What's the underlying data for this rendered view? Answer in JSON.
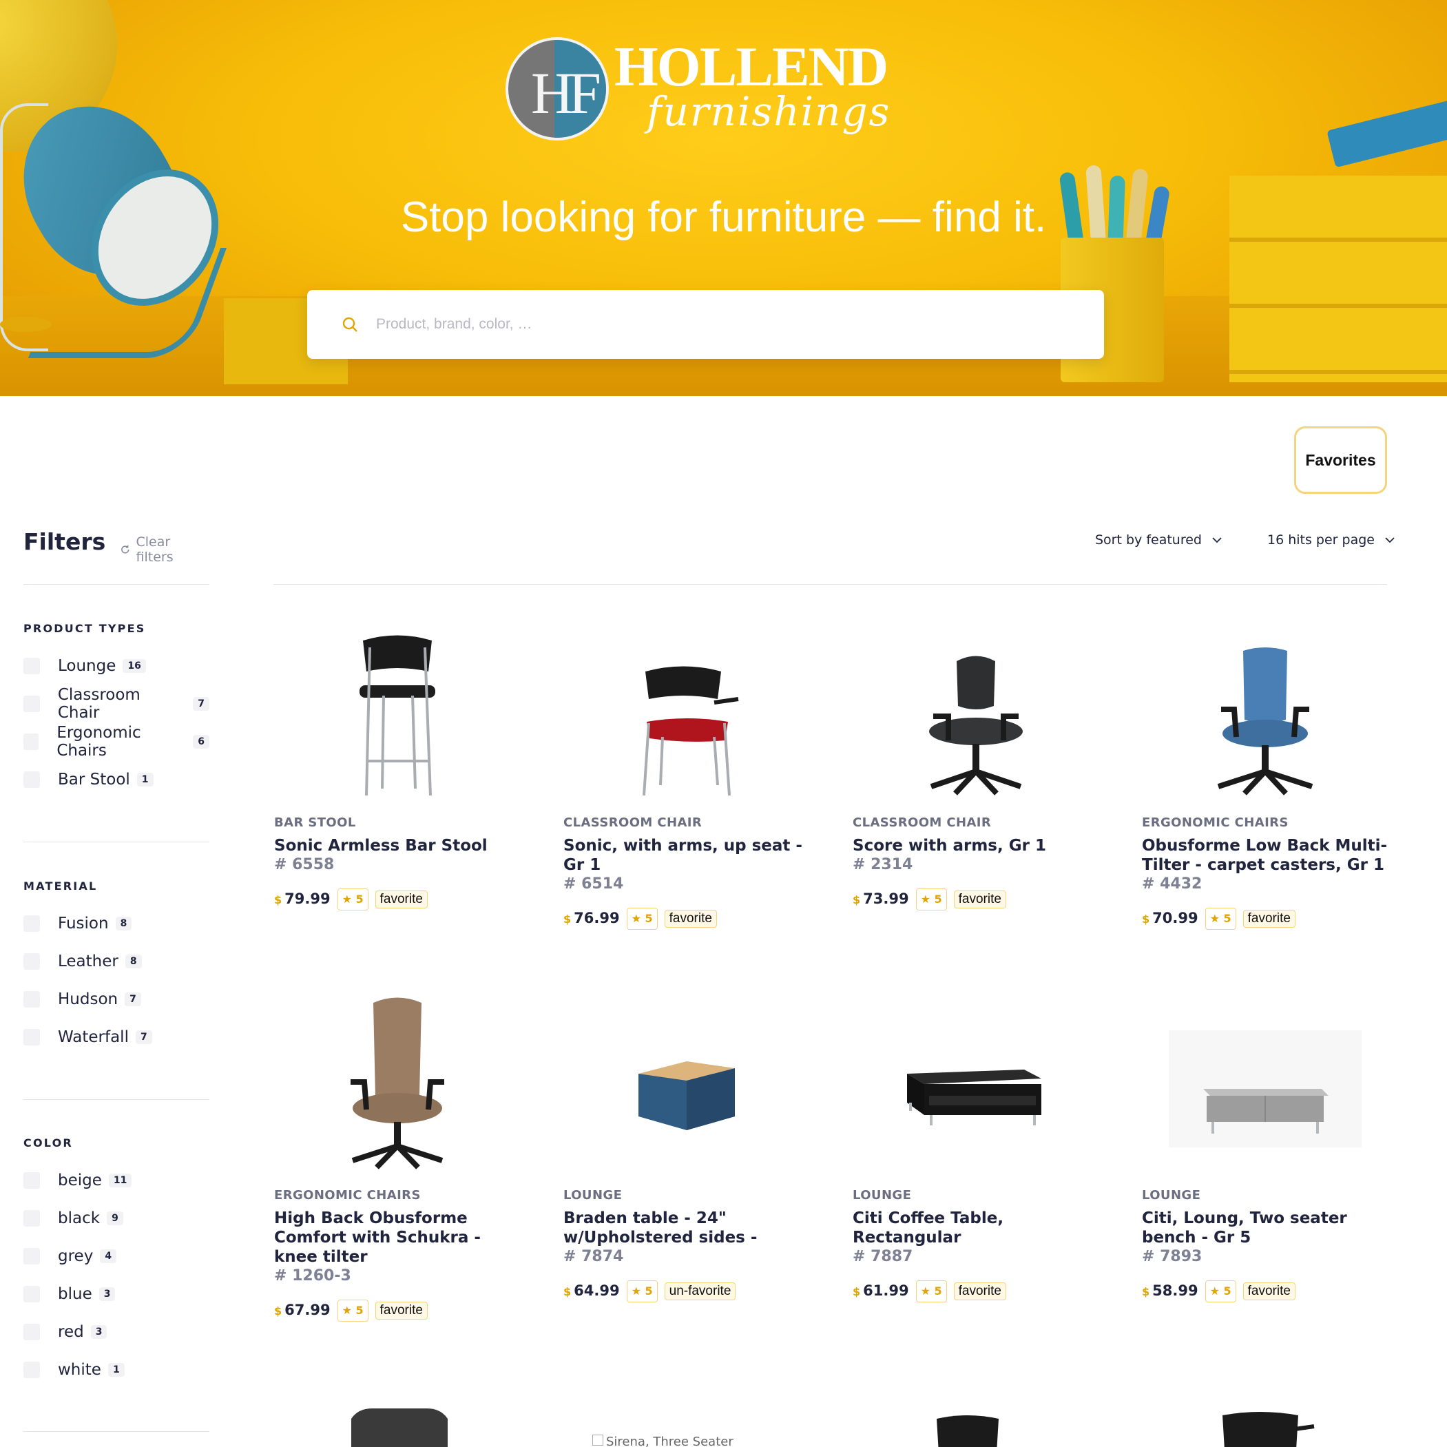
{
  "hero": {
    "brand_word": "HOLLEND",
    "brand_script": "furnishings",
    "brand_letters": "HF",
    "tagline": "Stop looking for furniture — find it.",
    "search_placeholder": "Product, brand, color, …"
  },
  "favorites_label": "Favorites",
  "filters": {
    "title": "Filters",
    "clear_label": "Clear filters",
    "facets": [
      {
        "title": "PRODUCT TYPES",
        "items": [
          {
            "label": "Lounge",
            "count": "16"
          },
          {
            "label": "Classroom Chair",
            "count": "7"
          },
          {
            "label": "Ergonomic Chairs",
            "count": "6"
          },
          {
            "label": "Bar Stool",
            "count": "1"
          }
        ]
      },
      {
        "title": "MATERIAL",
        "items": [
          {
            "label": "Fusion",
            "count": "8"
          },
          {
            "label": "Leather",
            "count": "8"
          },
          {
            "label": "Hudson",
            "count": "7"
          },
          {
            "label": "Waterfall",
            "count": "7"
          }
        ]
      },
      {
        "title": "COLOR",
        "items": [
          {
            "label": "beige",
            "count": "11"
          },
          {
            "label": "black",
            "count": "9"
          },
          {
            "label": "grey",
            "count": "4"
          },
          {
            "label": "blue",
            "count": "3"
          },
          {
            "label": "red",
            "count": "3"
          },
          {
            "label": "white",
            "count": "1"
          }
        ]
      }
    ]
  },
  "toolbar": {
    "sort_label": "Sort by featured",
    "hits_label": "16 hits per page"
  },
  "products": [
    {
      "category": "BAR STOOL",
      "name": "Sonic Armless Bar Stool",
      "sku": "# 6558",
      "currency": "$",
      "price": "79.99",
      "rating": "★ 5",
      "fav": "favorite",
      "image": "bar-stool"
    },
    {
      "category": "CLASSROOM CHAIR",
      "name": "Sonic, with arms, up seat - Gr 1",
      "sku": "# 6514",
      "currency": "$",
      "price": "76.99",
      "rating": "★ 5",
      "fav": "favorite",
      "image": "classroom-chair-red"
    },
    {
      "category": "CLASSROOM CHAIR",
      "name": "Score with arms, Gr 1",
      "sku": "# 2314",
      "currency": "$",
      "price": "73.99",
      "rating": "★ 5",
      "fav": "favorite",
      "image": "task-chair-black"
    },
    {
      "category": "ERGONOMIC CHAIRS",
      "name": "Obusforme Low Back Multi-Tilter - carpet casters, Gr 1",
      "sku": "# 4432",
      "currency": "$",
      "price": "70.99",
      "rating": "★ 5",
      "fav": "favorite",
      "image": "ergonomic-chair-blue"
    },
    {
      "category": "ERGONOMIC CHAIRS",
      "name": "High Back Obusforme Comfort with Schukra - knee tilter",
      "sku": "# 1260-3",
      "currency": "$",
      "price": "67.99",
      "rating": "★ 5",
      "fav": "favorite",
      "image": "ergonomic-chair-tan"
    },
    {
      "category": "LOUNGE",
      "name": "Braden table - 24\" w/Upholstered sides -",
      "sku": "# 7874",
      "currency": "$",
      "price": "64.99",
      "rating": "★ 5",
      "fav": "un-favorite",
      "image": "cube-table"
    },
    {
      "category": "LOUNGE",
      "name": "Citi Coffee Table, Rectangular",
      "sku": "# 7887",
      "currency": "$",
      "price": "61.99",
      "rating": "★ 5",
      "fav": "favorite",
      "image": "coffee-table"
    },
    {
      "category": "LOUNGE",
      "name": "Citi, Loung, Two seater bench - Gr 5",
      "sku": "# 7893",
      "currency": "$",
      "price": "58.99",
      "rating": "★ 5",
      "fav": "favorite",
      "image": "bench"
    }
  ],
  "partial_row": {
    "broken_image_alt": "Sirena, Three Seater"
  },
  "colors": {
    "accent": "#e2a400",
    "hero_yellow": "#f7bd08",
    "text": "#21243d",
    "muted": "#7e8093",
    "lamp_blue": "#3a8ba6"
  }
}
